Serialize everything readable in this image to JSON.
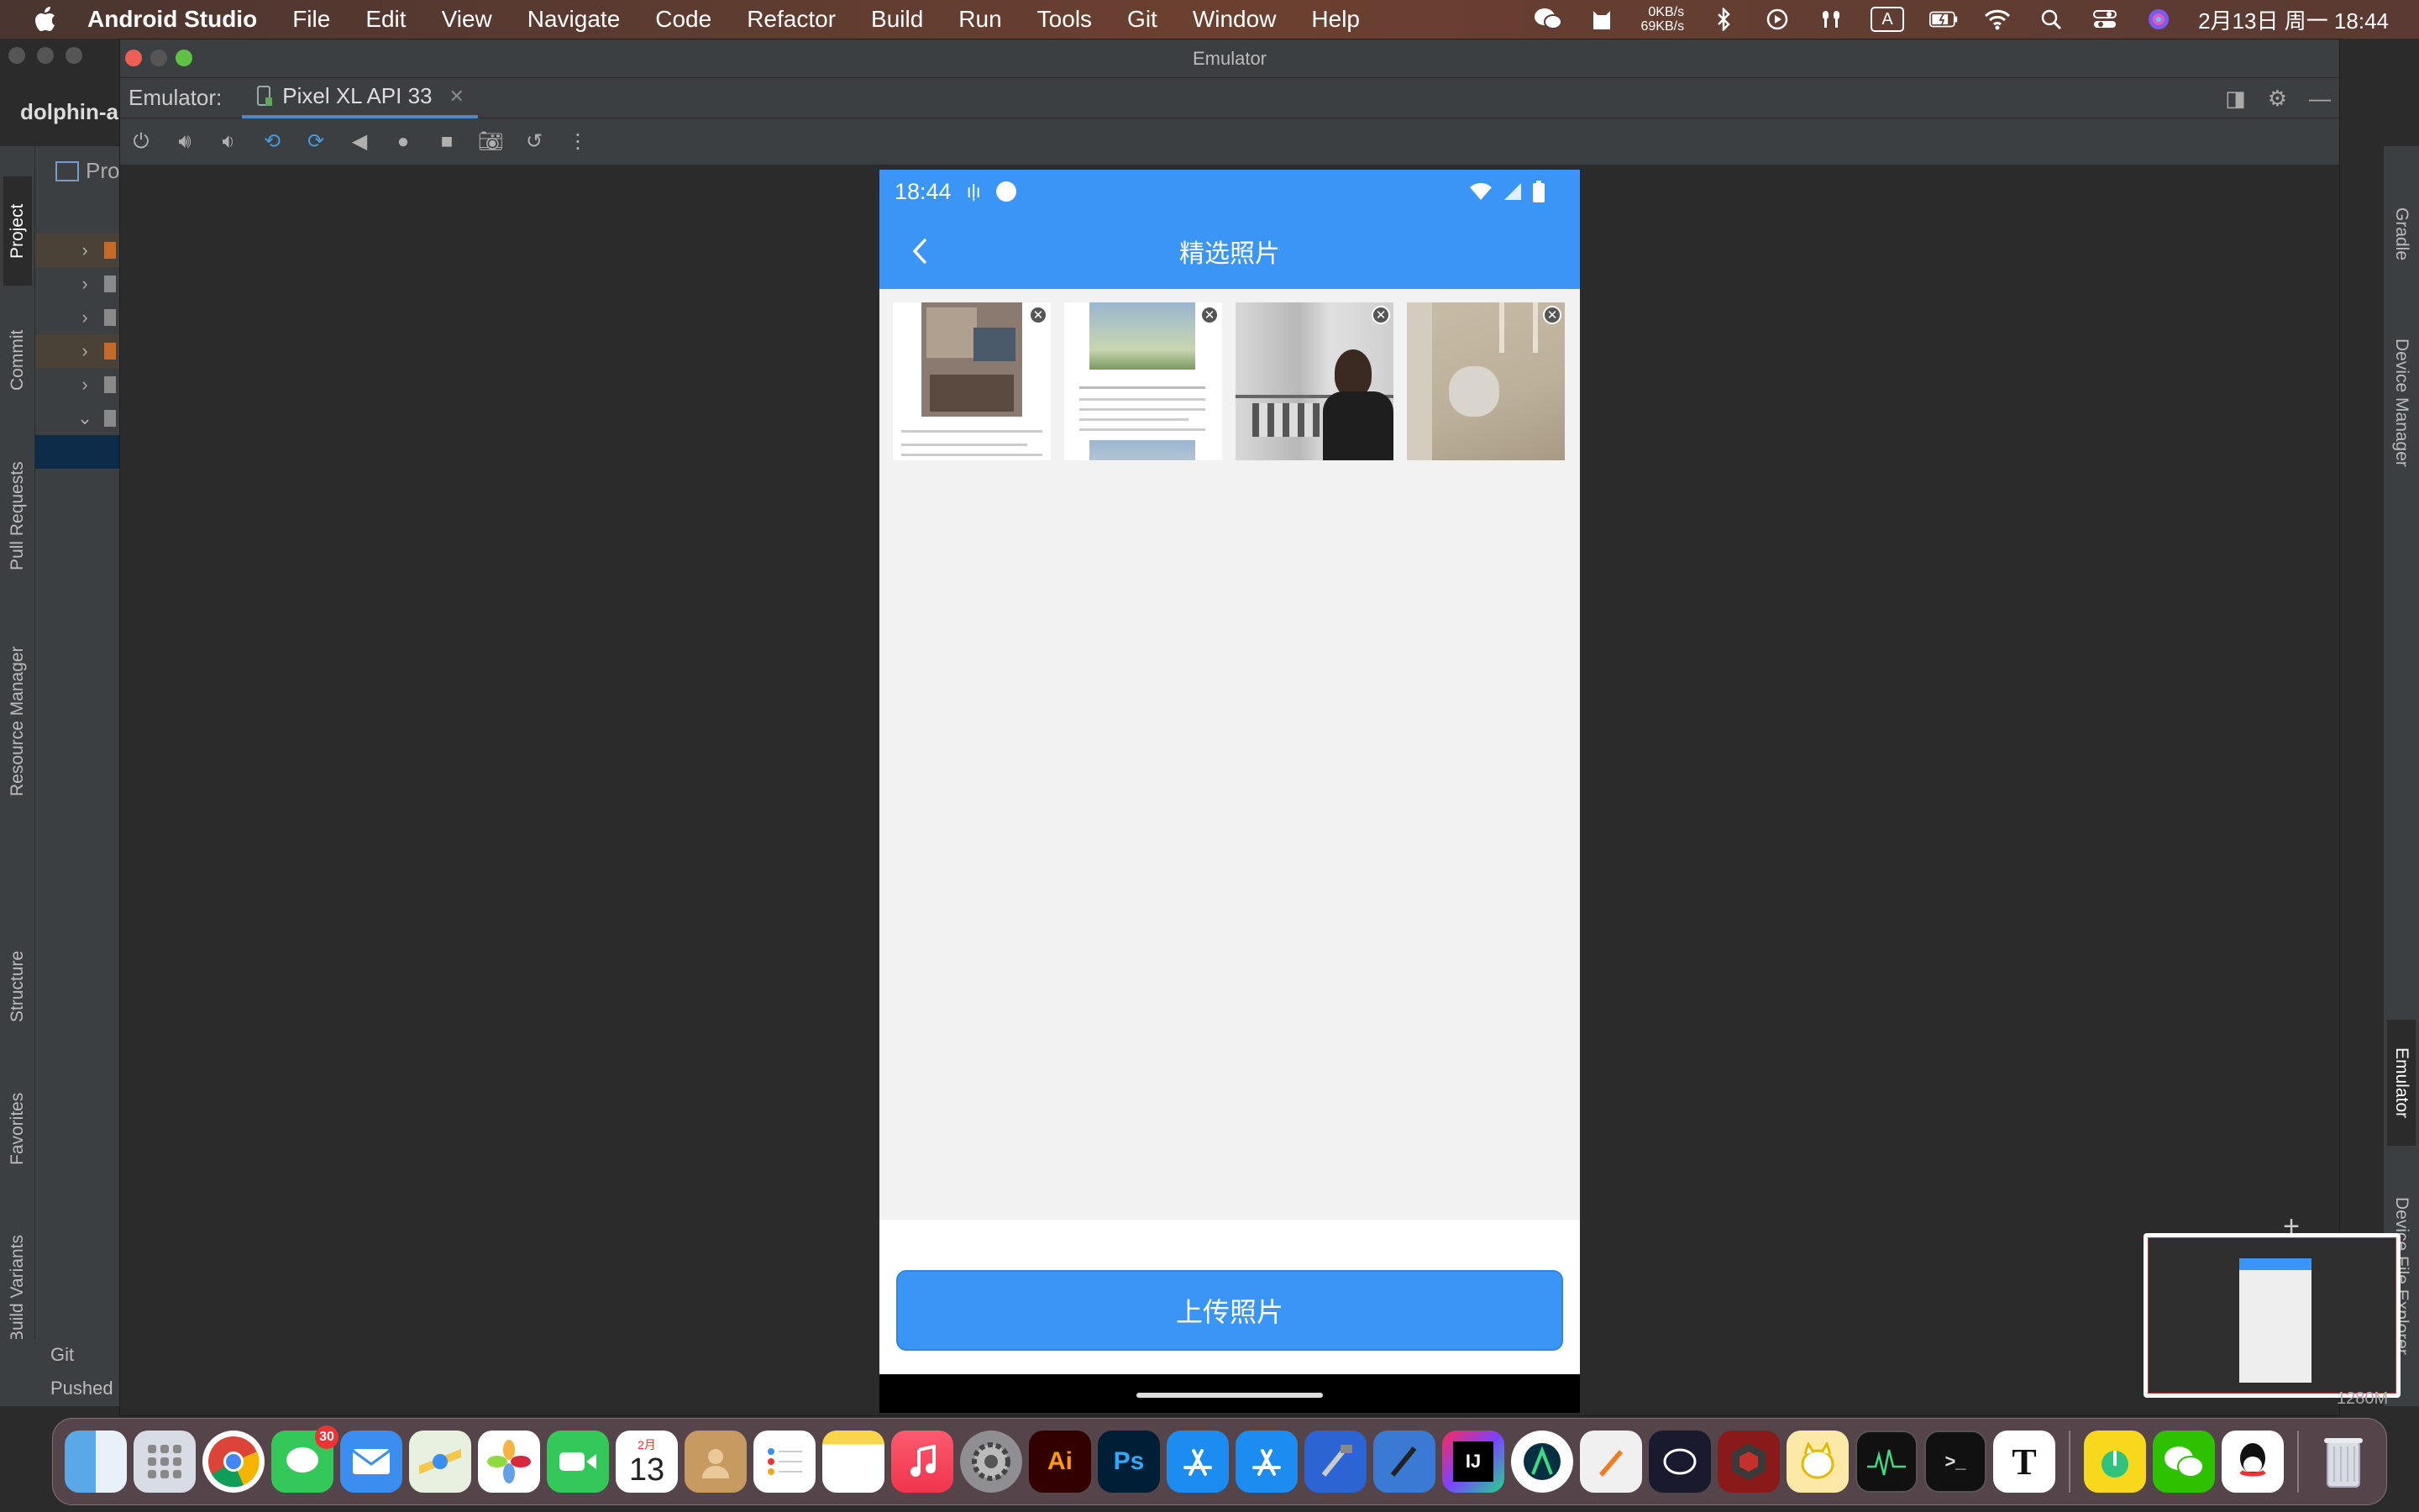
{
  "menubar": {
    "app_name": "Android Studio",
    "items": [
      "File",
      "Edit",
      "View",
      "Navigate",
      "Code",
      "Refactor",
      "Build",
      "Run",
      "Tools",
      "Git",
      "Window",
      "Help"
    ],
    "net_up": "0KB/s",
    "net_down": "69KB/s",
    "ime": "A",
    "datetime": "2月13日 周一  18:44"
  },
  "ide": {
    "project_name": "dolphin-a",
    "project_panel_title": "Pro",
    "left_tabs": [
      "Project",
      "Commit",
      "Pull Requests",
      "Resource Manager",
      "Structure",
      "Favorites",
      "Build Variants"
    ],
    "right_tabs": [
      "Gradle",
      "Device Manager",
      "Emulator",
      "Device File Explorer"
    ],
    "git_label": "Git",
    "status_text": "Pushed",
    "memory": "1280M"
  },
  "emulator": {
    "window_title": "Emulator",
    "label": "Emulator:",
    "device_tab": "Pixel XL API 33"
  },
  "phone": {
    "time": "18:44",
    "title": "精选照片",
    "upload_button": "上传照片",
    "photos": [
      {
        "name": "article-screenshot-1"
      },
      {
        "name": "article-screenshot-2"
      },
      {
        "name": "man-portrait"
      },
      {
        "name": "cat-on-floor"
      }
    ]
  },
  "dock": {
    "messages_badge": "30",
    "calendar_month": "2月",
    "calendar_day": "13"
  },
  "colors": {
    "accent": "#3b95f7",
    "ide_bg": "#2b2b2b",
    "panel_bg": "#3c3f41"
  }
}
